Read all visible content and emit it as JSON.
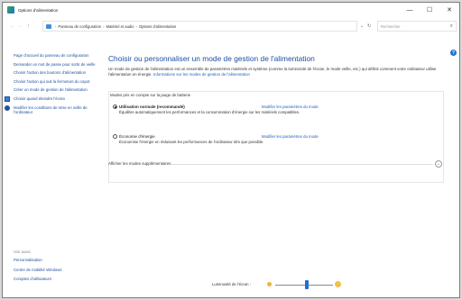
{
  "window": {
    "title": "Options d'alimentation",
    "minimize": "—",
    "maximize": "☐",
    "close": "✕"
  },
  "addressbar": {
    "back": "←",
    "forward": "→",
    "up": "↑",
    "breadcrumb": [
      "Panneau de configuration",
      "Matériel et audio",
      "Options d'alimentation"
    ],
    "separator": "›",
    "dropdown": "⌄",
    "refresh": "↻",
    "search_placeholder": "Rechercher",
    "search_icon": "⌕"
  },
  "help_label": "?",
  "sidebar": {
    "items": [
      {
        "label": "Page d'accueil du panneau de configuration",
        "icon": null
      },
      {
        "label": "Demander un mot de passe pour sortir de veille",
        "icon": null
      },
      {
        "label": "Choisir l'action des boutons d'alimentation",
        "icon": null
      },
      {
        "label": "Choisir l'action qui suit la fermeture du capot",
        "icon": null
      },
      {
        "label": "Créer un mode de gestion de l'alimentation",
        "icon": null
      },
      {
        "label": "Choisir quand éteindre l'écran",
        "icon": "display-icon"
      },
      {
        "label": "Modifier les conditions de mise en veille de l'ordinateur",
        "icon": "moon-icon"
      }
    ],
    "see_also_title": "Voir aussi",
    "see_also": [
      "Personnalisation",
      "Centre de mobilité Windows",
      "Comptes d'utilisateurs"
    ]
  },
  "main": {
    "heading": "Choisir ou personnaliser un mode de gestion de l'alimentation",
    "intro": "Un mode de gestion de l'alimentation est un ensemble de paramètres matériels et système (comme la luminosité de l'écran, le mode veille, etc.) qui définit comment votre ordinateur utilise l'alimentation en énergie.",
    "intro_link": "Informations sur les modes de gestion de l'alimentation",
    "group_label": "Modes pris en compte sur la jauge de batterie",
    "plans": [
      {
        "name": "Utilisation normale (recommandé)",
        "selected": true,
        "change_link": "Modifier les paramètres du mode",
        "description": "Équilibre automatiquement les performances et la consommation d'énergie sur les matériels compatibles."
      },
      {
        "name": "Économie d'énergie",
        "selected": false,
        "change_link": "Modifier les paramètres du mode",
        "description": "Économise l'énergie en réduisant les performances de l'ordinateur dès que possible."
      }
    ],
    "more_plans": "Afficher les modes supplémentaires",
    "expand_icon": "⌄"
  },
  "brightness": {
    "label": "Luminosité de l'écran :",
    "level": 0.55
  },
  "colors": {
    "link": "#1a4e9c",
    "heading": "#1e4fa0",
    "accent": "#1e6fd6"
  }
}
